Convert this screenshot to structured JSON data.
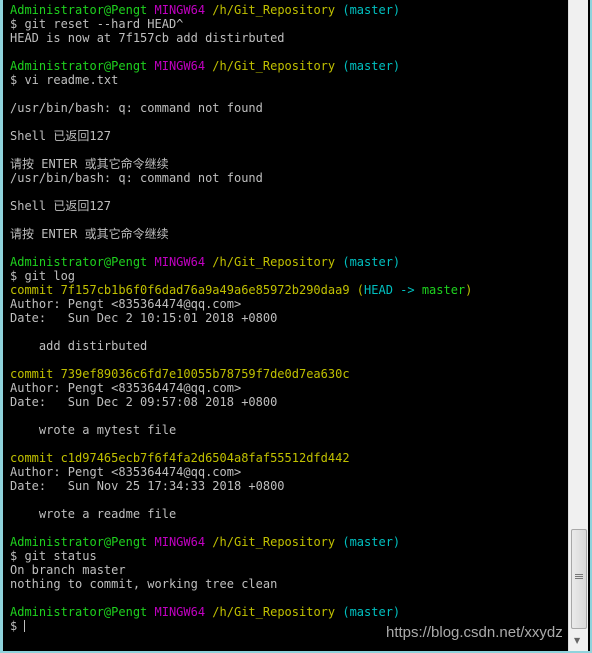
{
  "colors": {
    "green": "#1ed21e",
    "magenta": "#c000c0",
    "yellow": "#c0c000",
    "cyan": "#00c0c0",
    "text": "#bfbfbf",
    "background": "#000000"
  },
  "watermark": "https://blog.csdn.net/xxydz",
  "lines": [
    [
      [
        "green",
        "Administrator@Pengt "
      ],
      [
        "magenta",
        "MINGW64 "
      ],
      [
        "yellow",
        "/h/Git_Repository "
      ],
      [
        "cyan",
        "(master)"
      ]
    ],
    [
      [
        "gray",
        "$ git reset --hard HEAD^"
      ]
    ],
    [
      [
        "gray",
        "HEAD is now at 7f157cb add distirbuted"
      ]
    ],
    [],
    [
      [
        "green",
        "Administrator@Pengt "
      ],
      [
        "magenta",
        "MINGW64 "
      ],
      [
        "yellow",
        "/h/Git_Repository "
      ],
      [
        "cyan",
        "(master)"
      ]
    ],
    [
      [
        "gray",
        "$ vi readme.txt"
      ]
    ],
    [],
    [
      [
        "gray",
        "/usr/bin/bash: q: command not found"
      ]
    ],
    [],
    [
      [
        "gray",
        "Shell 已返回127"
      ]
    ],
    [],
    [
      [
        "gray",
        "请按 ENTER 或其它命令继续"
      ]
    ],
    [
      [
        "gray",
        "/usr/bin/bash: q: command not found"
      ]
    ],
    [],
    [
      [
        "gray",
        "Shell 已返回127"
      ]
    ],
    [],
    [
      [
        "gray",
        "请按 ENTER 或其它命令继续"
      ]
    ],
    [],
    [
      [
        "green",
        "Administrator@Pengt "
      ],
      [
        "magenta",
        "MINGW64 "
      ],
      [
        "yellow",
        "/h/Git_Repository "
      ],
      [
        "cyan",
        "(master)"
      ]
    ],
    [
      [
        "gray",
        "$ git log"
      ]
    ],
    [
      [
        "yellow",
        "commit 7f157cb1b6f0f6dad76a9a49a6e85972b290daa9 ("
      ],
      [
        "cyan",
        "HEAD -> "
      ],
      [
        "green",
        "master"
      ],
      [
        "yellow",
        ")"
      ]
    ],
    [
      [
        "gray",
        "Author: Pengt <835364474@qq.com>"
      ]
    ],
    [
      [
        "gray",
        "Date:   Sun Dec 2 10:15:01 2018 +0800"
      ]
    ],
    [],
    [
      [
        "gray",
        "    add distirbuted"
      ]
    ],
    [],
    [
      [
        "yellow",
        "commit 739ef89036c6fd7e10055b78759f7de0d7ea630c"
      ]
    ],
    [
      [
        "gray",
        "Author: Pengt <835364474@qq.com>"
      ]
    ],
    [
      [
        "gray",
        "Date:   Sun Dec 2 09:57:08 2018 +0800"
      ]
    ],
    [],
    [
      [
        "gray",
        "    wrote a mytest file"
      ]
    ],
    [],
    [
      [
        "yellow",
        "commit c1d97465ecb7f6f4fa2d6504a8faf55512dfd442"
      ]
    ],
    [
      [
        "gray",
        "Author: Pengt <835364474@qq.com>"
      ]
    ],
    [
      [
        "gray",
        "Date:   Sun Nov 25 17:34:33 2018 +0800"
      ]
    ],
    [],
    [
      [
        "gray",
        "    wrote a readme file"
      ]
    ],
    [],
    [
      [
        "green",
        "Administrator@Pengt "
      ],
      [
        "magenta",
        "MINGW64 "
      ],
      [
        "yellow",
        "/h/Git_Repository "
      ],
      [
        "cyan",
        "(master)"
      ]
    ],
    [
      [
        "gray",
        "$ git status"
      ]
    ],
    [
      [
        "gray",
        "On branch master"
      ]
    ],
    [
      [
        "gray",
        "nothing to commit, working tree clean"
      ]
    ],
    [],
    [
      [
        "green",
        "Administrator@Pengt "
      ],
      [
        "magenta",
        "MINGW64 "
      ],
      [
        "yellow",
        "/h/Git_Repository "
      ],
      [
        "cyan",
        "(master)"
      ]
    ],
    [
      [
        "gray",
        "$ "
      ]
    ]
  ]
}
